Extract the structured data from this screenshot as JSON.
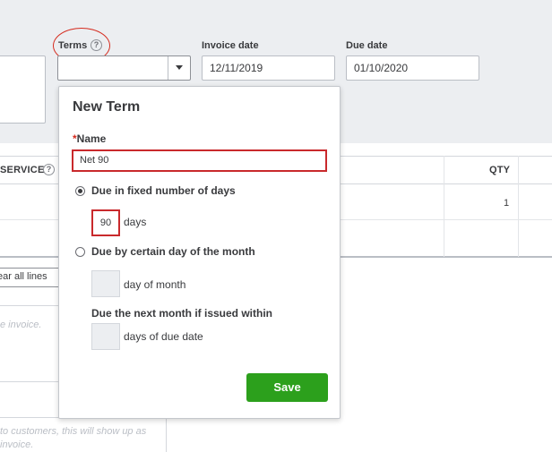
{
  "form": {
    "terms_label": "Terms",
    "invoice_date_label": "Invoice date",
    "invoice_date_value": "12/11/2019",
    "due_date_label": "Due date",
    "due_date_value": "01/10/2020",
    "help_glyph": "?"
  },
  "table": {
    "service_header": "SERVICE",
    "qty_header": "QTY",
    "row1_qty": "1",
    "clear_lines_label": "ear all lines",
    "memo_ghost": "e invoice.",
    "message_ghost_line1": "to customers, this will show up as",
    "message_ghost_line2": "invoice."
  },
  "popup": {
    "title": "New Term",
    "required_marker": "*",
    "name_label": "Name",
    "name_value": "Net 90",
    "option_fixed_label": "Due in fixed number of days",
    "option_fixed_checked": true,
    "days_value": "90",
    "days_suffix": "days",
    "option_day_of_month_label": "Due by certain day of the month",
    "option_day_of_month_checked": false,
    "day_of_month_suffix": "day of month",
    "next_month_label": "Due the next month if issued within",
    "days_of_due_date_suffix": "days of due date",
    "save_label": "Save"
  },
  "colors": {
    "accent_green": "#2ca01c",
    "highlight_red": "#c9292c",
    "band_gray": "#eceef1"
  }
}
